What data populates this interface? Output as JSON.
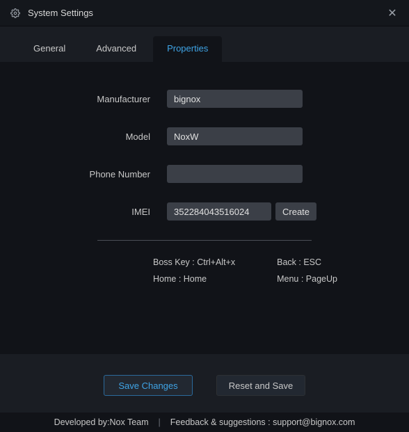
{
  "window": {
    "title": "System Settings"
  },
  "tabs": {
    "general": "General",
    "advanced": "Advanced",
    "properties": "Properties"
  },
  "form": {
    "manufacturer": {
      "label": "Manufacturer",
      "value": "bignox"
    },
    "model": {
      "label": "Model",
      "value": "NoxW"
    },
    "phone": {
      "label": "Phone Number",
      "value": ""
    },
    "imei": {
      "label": "IMEI",
      "value": "352284043516024",
      "create_label": "Create"
    }
  },
  "shortcuts": {
    "bosskey": "Boss Key : Ctrl+Alt+x",
    "home": "Home : Home",
    "back": "Back : ESC",
    "menu": "Menu : PageUp"
  },
  "buttons": {
    "save": "Save Changes",
    "reset": "Reset and Save"
  },
  "footer": {
    "developed": "Developed by:Nox Team",
    "feedback": "Feedback & suggestions : support@bignox.com"
  }
}
